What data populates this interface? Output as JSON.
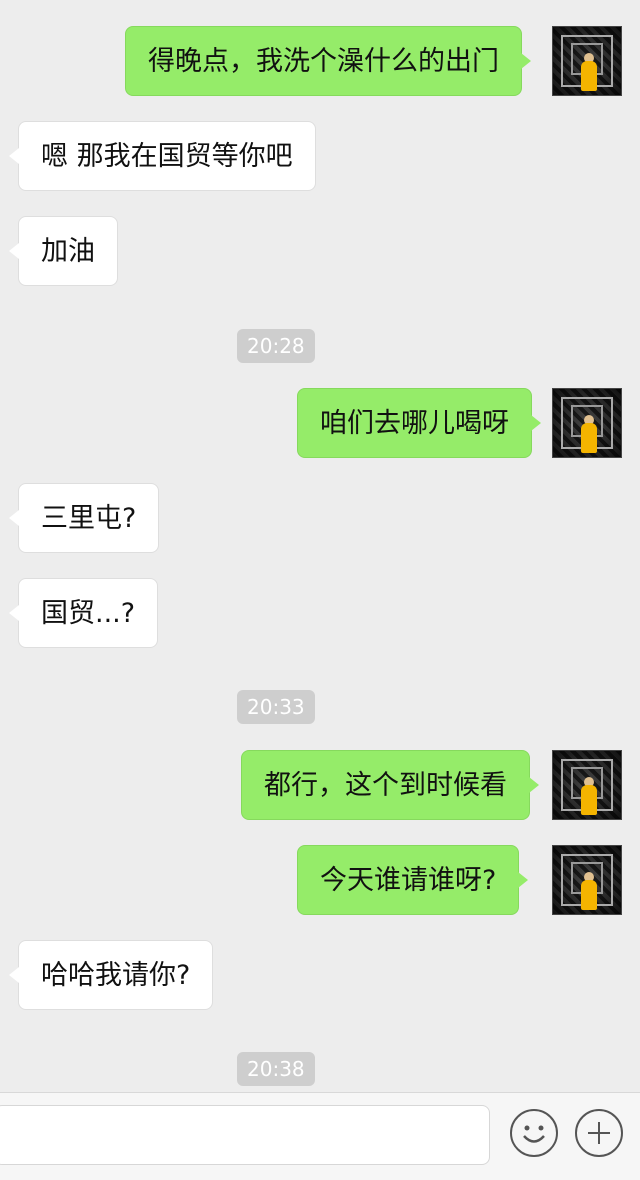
{
  "messages": [
    {
      "side": "out",
      "text": "得晚点，我洗个澡什么的出门"
    },
    {
      "side": "in",
      "text": "嗯 那我在国贸等你吧"
    },
    {
      "side": "in",
      "text": "加油"
    },
    {
      "side": "time",
      "text": "20:28"
    },
    {
      "side": "out",
      "text": "咱们去哪儿喝呀"
    },
    {
      "side": "in",
      "text": "三里屯?"
    },
    {
      "side": "in",
      "text": "国贸...?"
    },
    {
      "side": "time",
      "text": "20:33"
    },
    {
      "side": "out",
      "text": "都行，这个到时候看"
    },
    {
      "side": "out",
      "text": "今天谁请谁呀?"
    },
    {
      "side": "in",
      "text": "哈哈我请你?"
    },
    {
      "side": "time",
      "text": "20:38"
    }
  ],
  "input_bar": {
    "text_value": "",
    "emoji_icon": "emoji-icon",
    "plus_icon": "plus-icon"
  },
  "colors": {
    "background": "#ededed",
    "outgoing_bubble": "#95ec69",
    "incoming_bubble": "#ffffff",
    "timestamp_pill": "#cecece"
  }
}
